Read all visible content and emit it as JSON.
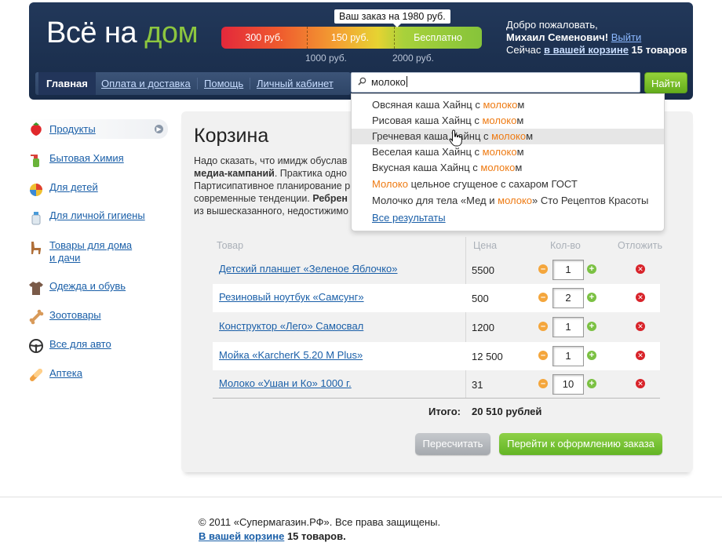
{
  "header": {
    "logo_main": "Всё на",
    "logo_accent": "дом",
    "order_tip": "Ваш заказ на 1980 руб.",
    "bar": {
      "seg1": "300 руб.",
      "seg2": "150 руб.",
      "seg3": "Бесплатно",
      "tick1": "1000 руб.",
      "tick2": "2000 руб."
    },
    "welcome_line1": "Добро пожаловать,",
    "user_name": "Михаил Семенович",
    "exclam": "!",
    "logout": "Выйти",
    "cart_prefix": "Сейчас",
    "cart_link": "в вашей корзине",
    "cart_count": "15 товаров"
  },
  "nav": {
    "items": [
      {
        "label": "Главная"
      },
      {
        "label": "Оплата и доставка"
      },
      {
        "label": "Помощь"
      },
      {
        "label": "Личный кабинет"
      }
    ]
  },
  "search": {
    "value": "молоко",
    "button": "Найти",
    "suggestions": [
      {
        "pre": "Овсяная каша Хайнц с ",
        "hl": "молоко",
        "post": "м"
      },
      {
        "pre": "Рисовая каша Хайнц с ",
        "hl": "молоко",
        "post": "м"
      },
      {
        "pre": "Гречневая каша Хайнц с ",
        "hl": "молоко",
        "post": "м"
      },
      {
        "pre": "Веселая каша Хайнц с ",
        "hl": "молоко",
        "post": "м"
      },
      {
        "pre": "Вкусная каша Хайнц с ",
        "hl": "молоко",
        "post": "м"
      },
      {
        "pre": "",
        "hl": "Молоко",
        "post": " цельное сгущеное с сахаром ГОСТ"
      },
      {
        "pre": "Молочко для тела «Мед и ",
        "hl": "молоко",
        "post": "» Сто Рецептов Красоты"
      }
    ],
    "all_results": "Все результаты"
  },
  "sidebar": {
    "items": [
      {
        "label": "Продукты",
        "icon": "strawberry-icon"
      },
      {
        "label": "Бытовая Химия",
        "icon": "spray-bottle-icon"
      },
      {
        "label": "Для детей",
        "icon": "beach-ball-icon"
      },
      {
        "label": "Для личной гигиены",
        "icon": "lotion-bottle-icon"
      },
      {
        "label": "Товары для дома",
        "label2": "и дачи",
        "icon": "chair-icon"
      },
      {
        "label": "Одежда и обувь",
        "icon": "shirt-icon"
      },
      {
        "label": "Зоотовары",
        "icon": "bone-icon"
      },
      {
        "label": "Все для авто",
        "icon": "steering-wheel-icon"
      },
      {
        "label": "Аптека",
        "icon": "pill-icon"
      }
    ]
  },
  "main": {
    "title": "Корзина",
    "para": {
      "t1": "Надо сказать, что имидж обуслав",
      "b1": "медиа-кампаний",
      "t2": ". Практика одно",
      "t3": "Партисипативное планирование р",
      "t4": "современные тенденции. ",
      "b2": "Ребрен",
      "t5": "из вышесказанного, недостижимо"
    },
    "columns": {
      "product": "Товар",
      "price": "Цена",
      "qty": "Кол-во",
      "defer": "Отложить"
    },
    "rows": [
      {
        "name": "Детский планшет «Зеленое Яблочко»",
        "price": "5500",
        "qty": "1"
      },
      {
        "name": "Резиновый ноутбук «Самсунг»",
        "price": "500",
        "qty": "2"
      },
      {
        "name": "Конструктор «Лего» Самосвал",
        "price": "1200",
        "qty": "1"
      },
      {
        "name": "Мойка «KarcherK 5.20 M Plus»",
        "price": "12 500",
        "qty": "1"
      },
      {
        "name": "Молоко «Ушан и Ко» 1000 г.",
        "price": "31",
        "qty": "10"
      }
    ],
    "total_label": "Итого:",
    "total_value": "20 510 рублей",
    "recalc": "Пересчитать",
    "checkout": "Перейти к оформлению заказа"
  },
  "footer": {
    "copyright": "© 2011 «Супермагазин.РФ». Все права защищены.",
    "cart_link": "В вашей корзине",
    "cart_count": "15 товаров."
  },
  "colors": {
    "header_bg": "#1c3050",
    "accent_green": "#8cc63f",
    "link": "#1a5fa8",
    "highlight": "#ee7a12"
  }
}
